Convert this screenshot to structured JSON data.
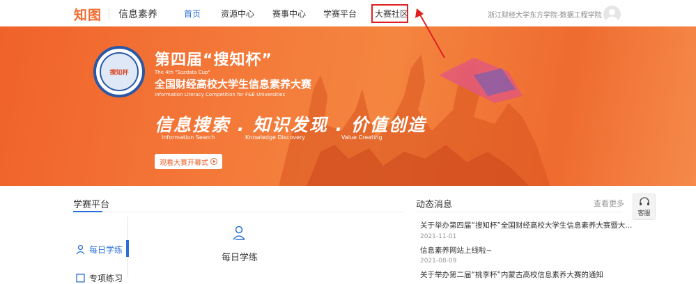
{
  "header": {
    "logo_text": "知图",
    "logo_subtitle": "信息素养",
    "nav": [
      {
        "label": "首页",
        "active": true
      },
      {
        "label": "资源中心",
        "active": false
      },
      {
        "label": "赛事中心",
        "active": false
      },
      {
        "label": "学赛平台",
        "active": false
      },
      {
        "label": "大赛社区",
        "active": false
      }
    ],
    "school": "浙江财经大学东方学院-数据工程学院",
    "accent_color": "#2b6fd6",
    "highlight_color": "#e02020"
  },
  "banner": {
    "badge_text": "搜知杯",
    "title": "第四届“搜知杯”",
    "title_en": "The 4th \"Sozdata Cup\"",
    "subtitle": "全国财经高校大学生信息素养大赛",
    "subtitle_en": "Information Literacy Competition for F&E Universities",
    "slogan": "信息搜索 . 知识发现 . 价值创造",
    "slogan_en": [
      "Information Search",
      "Knowledge Discovery",
      "Value Creating"
    ],
    "button_label": "观看大赛开幕式",
    "bg_color": "#f26a2e"
  },
  "platform": {
    "title": "学赛平台",
    "side_items": [
      {
        "label": "每日学练",
        "icon": "user-study-icon",
        "active": true
      },
      {
        "label": "专项练习",
        "icon": "practice-icon",
        "active": false
      }
    ],
    "center_label": "每日学练"
  },
  "news": {
    "title": "动态消息",
    "more_label": "查看更多",
    "items": [
      {
        "title": "关于举办第四届“搜知杯”全国财经高校大学生信息素养大赛暨大...",
        "date": "2021-11-01"
      },
      {
        "title": "信息素养网站上线啦~",
        "date": "2021-08-09"
      },
      {
        "title": "关于举办第二届“桃李杯”内蒙古高校信息素养大赛的通知",
        "date": ""
      }
    ]
  },
  "service": {
    "label": "客服"
  }
}
